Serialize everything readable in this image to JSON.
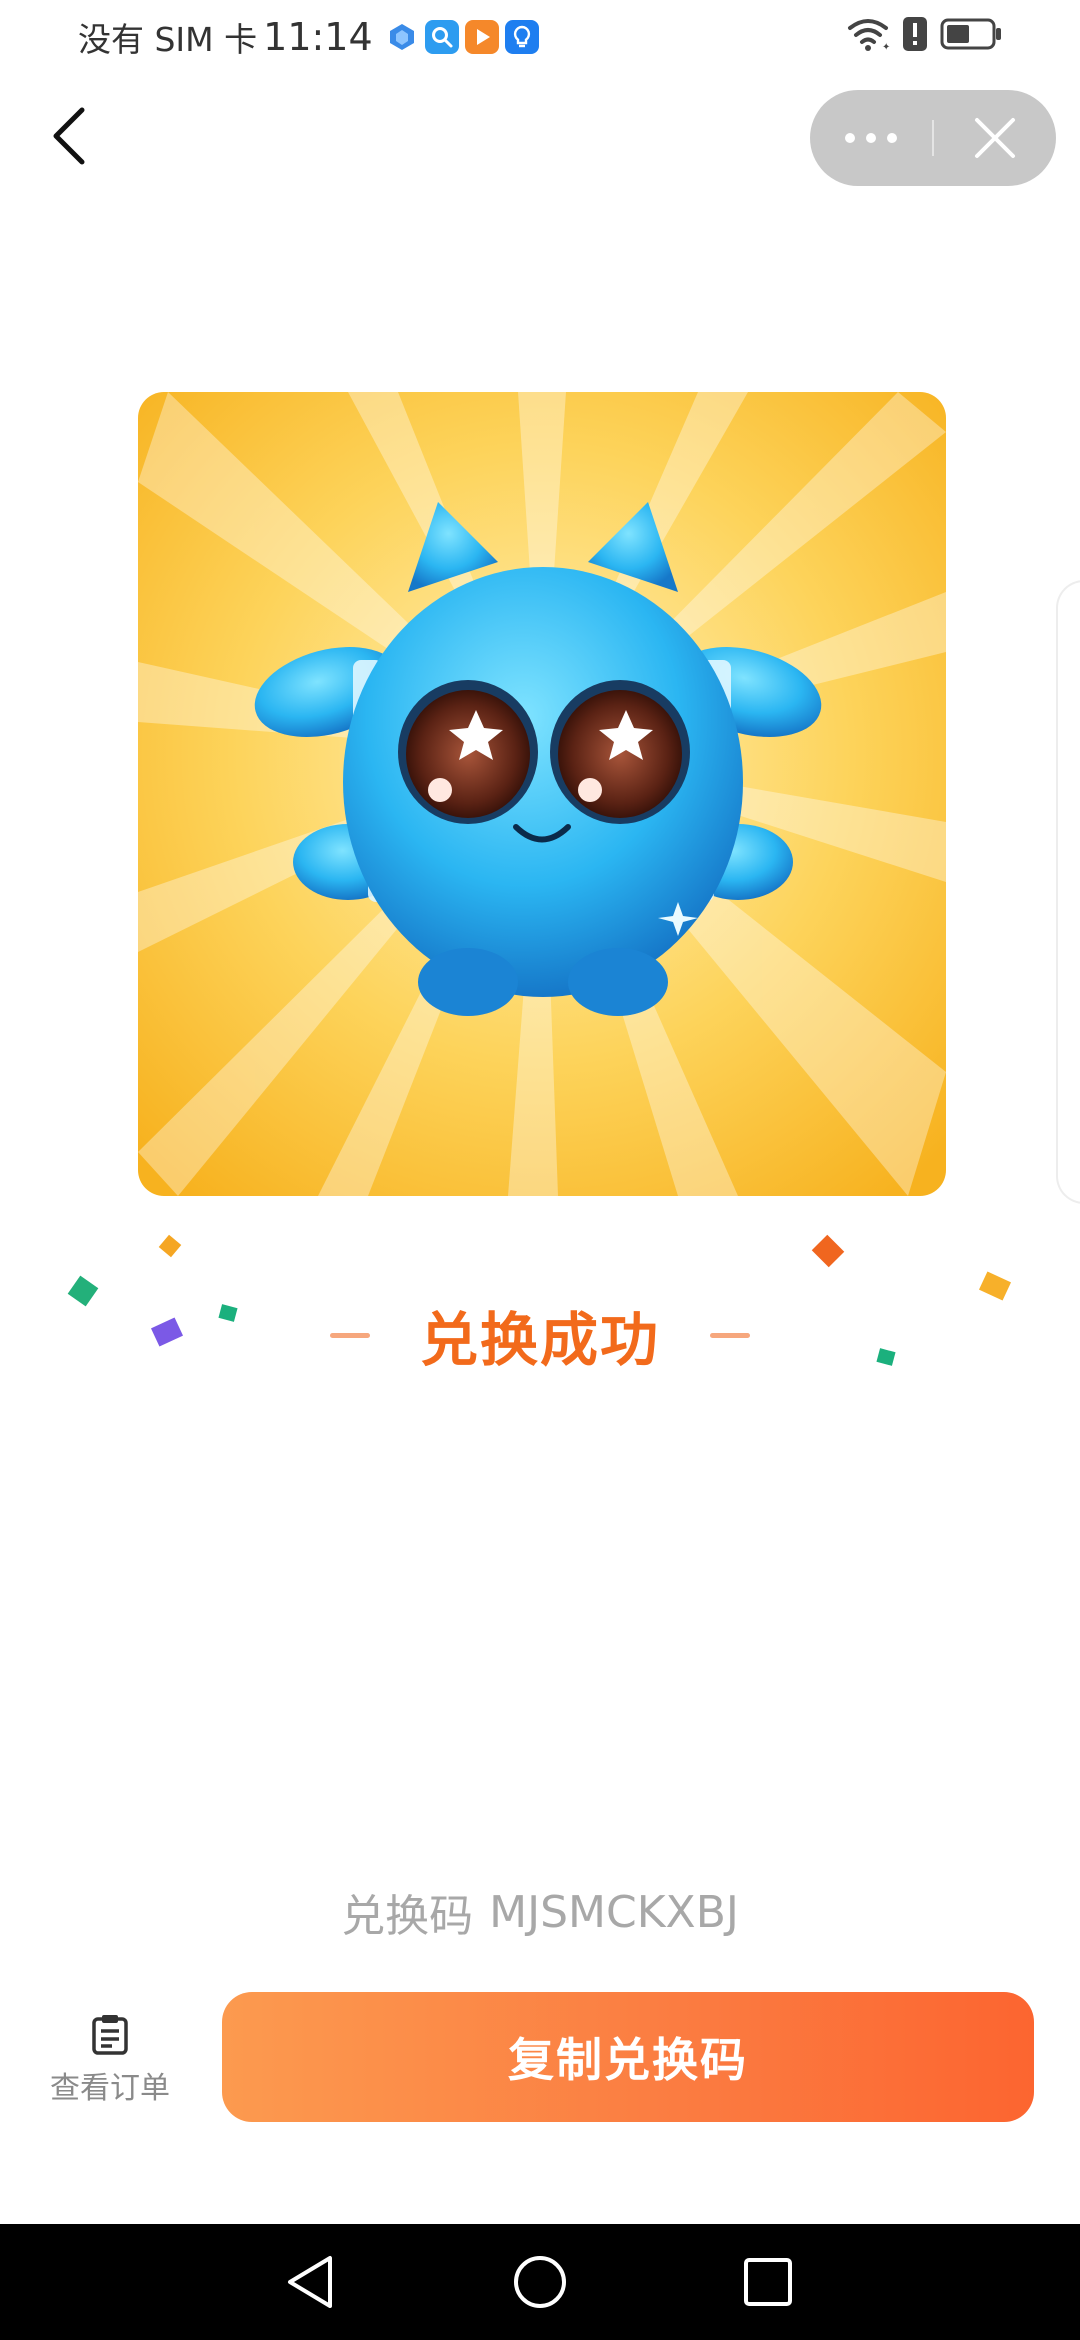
{
  "status_bar": {
    "carrier": "没有 SIM 卡",
    "time": "11:14",
    "notification_icons": [
      "app-notification-icon",
      "search-app-icon",
      "video-app-icon",
      "bulb-app-icon"
    ],
    "right_icons": [
      "wifi-icon",
      "alert-icon",
      "battery-icon"
    ]
  },
  "nav": {
    "back_icon": "chevron-left-icon",
    "more_icon": "more-dots-icon",
    "close_icon": "close-icon"
  },
  "product": {
    "image_icon": "blue-monster-character"
  },
  "result": {
    "title": "兑换成功"
  },
  "code": {
    "label": "兑换码",
    "value": "MJSMCKXBJ"
  },
  "actions": {
    "view_order_label": "查看订单",
    "view_order_icon": "clipboard-icon",
    "copy_label": "复制兑换码"
  },
  "colors": {
    "accent": "#f26a1b",
    "button_start": "#fc9a4f",
    "button_end": "#fc6530",
    "code_text": "#a8a8a8"
  }
}
